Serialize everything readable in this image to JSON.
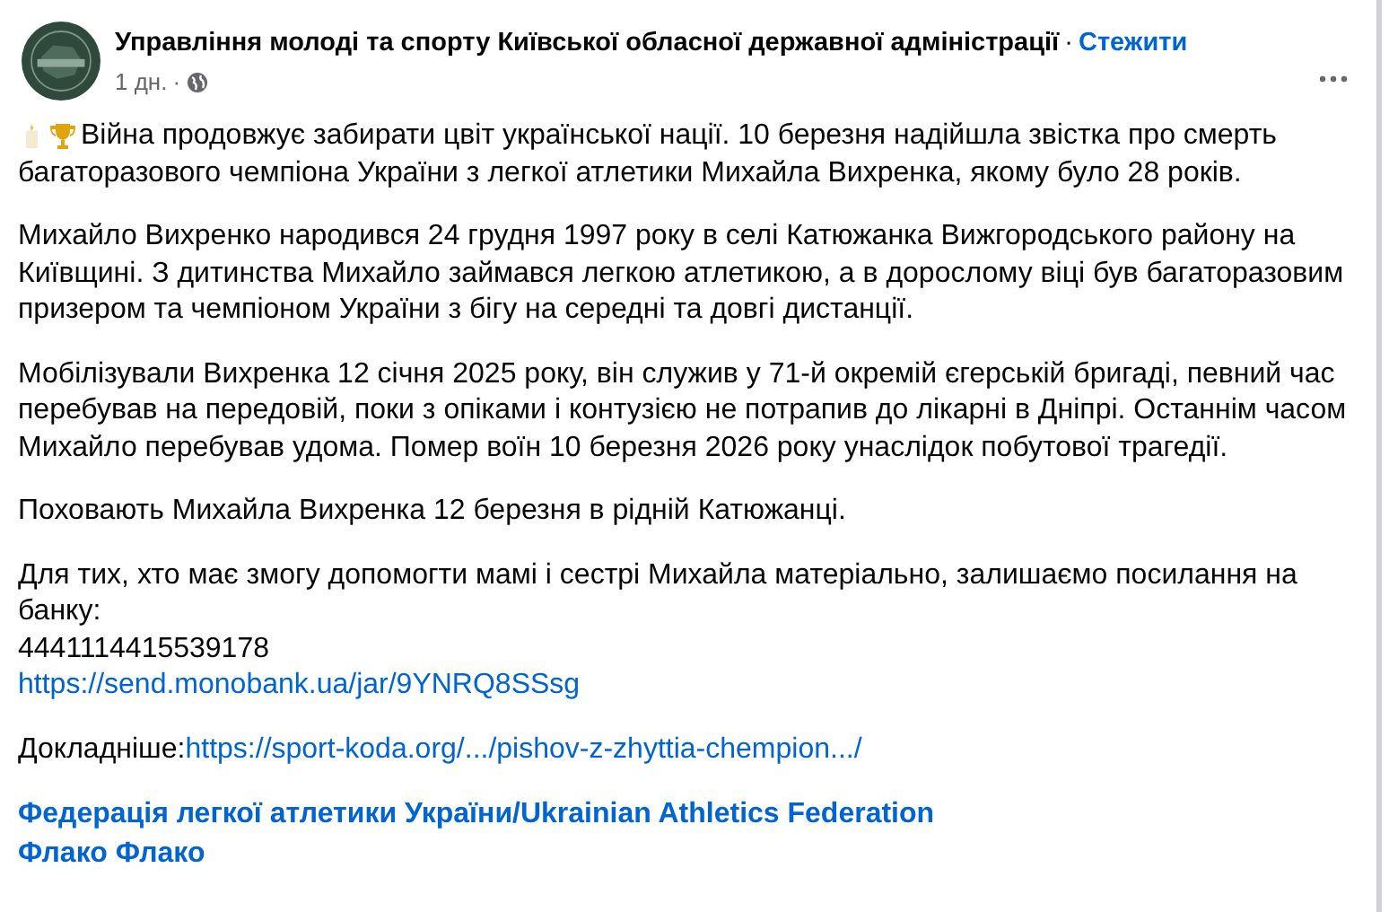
{
  "post": {
    "author": "Управління молоді та спорту Київської обласної державної адміністрації",
    "separator": "·",
    "follow": "Стежити",
    "time": "1 дн.",
    "time_separator": "·"
  },
  "intro": [
    "Війна продовжує забирати цвіт української нації. 10 березня надійшла звістка про смерть",
    "багаторазового чемпіона України з легкої атлетики Михайла Вихренка, якому було 28 років."
  ],
  "paragraphs": [
    "Михайло Вихренко народився 24 грудня 1997 року в селі Катюжанка Вижгородського району на Київщині. З дитинства Михайло займався легкою атлетикою, а в дорослому віці був багаторазовим призером та чемпіоном України з бігу на середні та довгі дистанції.",
    "Мобілізували Вихренка 12 січня 2025 року, він служив у 71-й окремій єгерській бригаді, певний час перебував на передовій, поки з опіками і контузією не потрапив до лікарні в Дніпрі. Останнім часом Михайло перебував удома. Помер воїн 10 березня 2026 року унаслідок побутової трагедії.",
    "Поховають Михайла Вихренка 12 березня в рідній Катюжанці."
  ],
  "donation": {
    "text": "Для тих, хто має змогу допомогти мамі і сестрі Михайла матеріально, залишаємо посилання на банку:",
    "card": "4441114415539178",
    "link": "https://send.monobank.ua/jar/9YNRQ8SSsg"
  },
  "more": {
    "label": "Докладніше:",
    "link": "https://sport-koda.org/.../pishov-z-zhyttia-chempion.../"
  },
  "tags": [
    "Федерація легкої атлетики України/Ukrainian Athletics Federation",
    "Флако Флако"
  ]
}
